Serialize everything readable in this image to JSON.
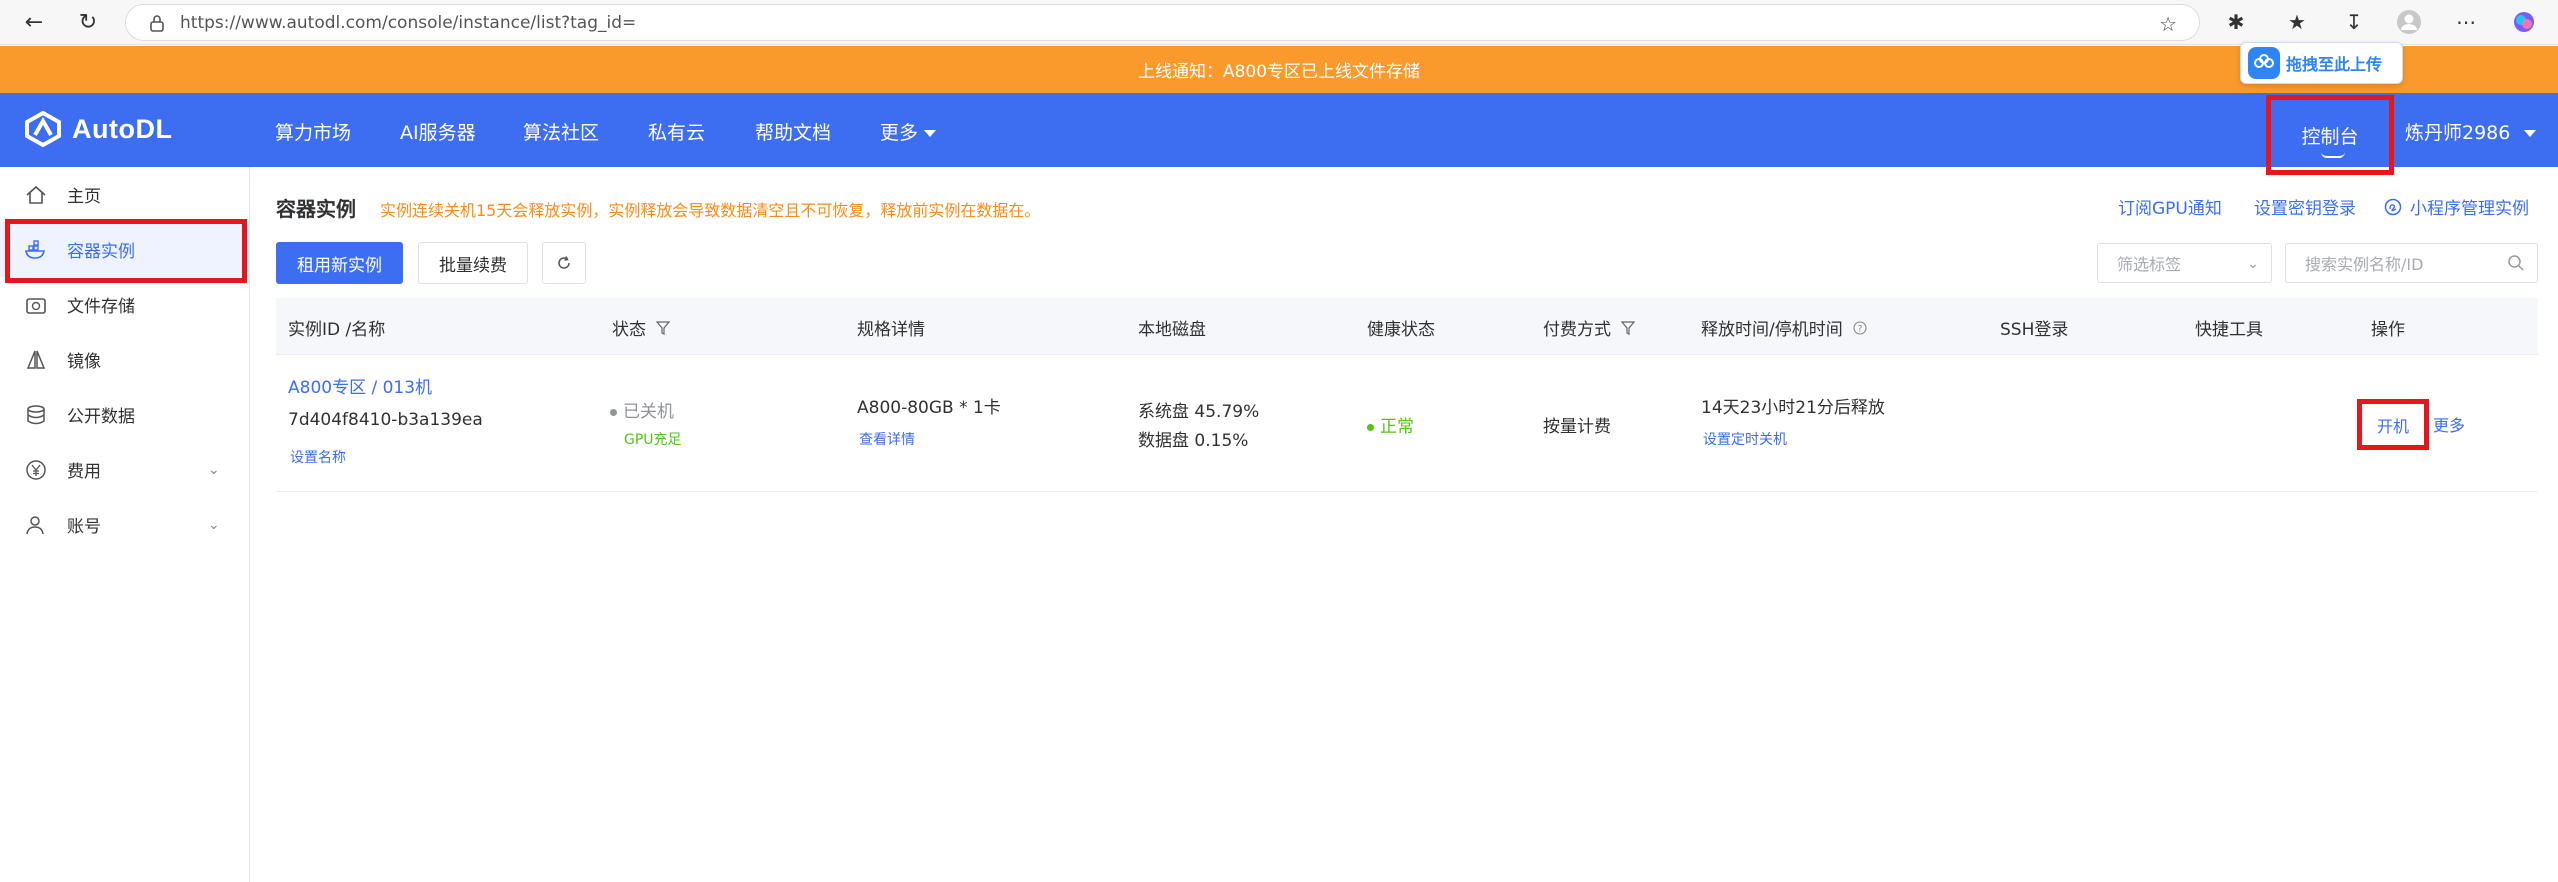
{
  "browser": {
    "url": "https://www.autodl.com/console/instance/list?tag_id="
  },
  "notice": {
    "text": "上线通知：A800专区已上线文件存储",
    "upload_tip": "拖拽至此上传"
  },
  "topnav": {
    "logo": "AutoDL",
    "items": [
      "算力市场",
      "AI服务器",
      "算法社区",
      "私有云",
      "帮助文档",
      "更多"
    ],
    "console": "控制台",
    "user": "炼丹师2986"
  },
  "sidebar": {
    "items": [
      {
        "label": "主页",
        "icon": "home-icon"
      },
      {
        "label": "容器实例",
        "icon": "container-icon"
      },
      {
        "label": "文件存储",
        "icon": "storage-icon"
      },
      {
        "label": "镜像",
        "icon": "image-icon"
      },
      {
        "label": "公开数据",
        "icon": "database-icon"
      },
      {
        "label": "费用",
        "icon": "yen-icon"
      },
      {
        "label": "账号",
        "icon": "user-icon"
      }
    ]
  },
  "main": {
    "title": "容器实例",
    "warning": "实例连续关机15天会释放实例，实例释放会导致数据清空且不可恢复，释放前实例在数据在。",
    "links": [
      "订阅GPU通知",
      "设置密钥登录",
      "小程序管理实例"
    ],
    "buttons": {
      "rent": "租用新实例",
      "renew": "批量续费"
    },
    "filter_placeholder": "筛选标签",
    "search_placeholder": "搜索实例名称/ID"
  },
  "table": {
    "headers": [
      "实例ID /名称",
      "状态",
      "规格详情",
      "本地磁盘",
      "健康状态",
      "付费方式",
      "释放时间/停机时间",
      "SSH登录",
      "快捷工具",
      "操作"
    ],
    "row": {
      "name": "A800专区 / 013机",
      "id": "7d404f8410-b3a139ea",
      "set_name": "设置名称",
      "status": "已关机",
      "gpu_status": "GPU充足",
      "spec": "A800-80GB * 1卡",
      "spec_link": "查看详情",
      "disk_sys": "系统盘 45.79%",
      "disk_data": "数据盘 0.15%",
      "health": "正常",
      "billing": "按量计费",
      "release": "14天23小时21分后释放",
      "shutdown_link": "设置定时关机",
      "op_start": "开机",
      "op_more": "更多"
    }
  },
  "colors": {
    "primary": "#3d6df0",
    "notice": "#fa9a2c",
    "highlight": "#e5161c",
    "warn": "#fa8c16",
    "ok": "#52c41a"
  }
}
